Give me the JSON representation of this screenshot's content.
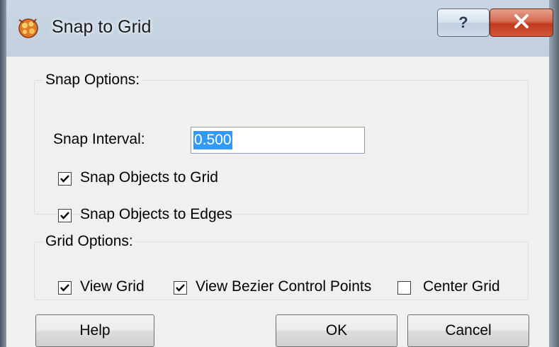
{
  "window": {
    "title": "Snap to Grid",
    "help_glyph": "?",
    "close_glyph": "X"
  },
  "snap_options": {
    "legend": "Snap Options:",
    "interval_label": "Snap Interval:",
    "interval_value": "0.500",
    "snap_objects_to_grid": {
      "label": "Snap Objects to Grid",
      "checked": true
    },
    "snap_objects_to_edges": {
      "label": "Snap Objects to Edges",
      "checked": true
    }
  },
  "grid_options": {
    "legend": "Grid Options:",
    "view_grid": {
      "label": "View Grid",
      "checked": true
    },
    "view_bezier_control_points": {
      "label": "View Bezier Control Points",
      "checked": true
    },
    "center_grid": {
      "label": "Center Grid",
      "checked": false
    }
  },
  "buttons": {
    "help": "Help",
    "ok": "OK",
    "cancel": "Cancel"
  },
  "icons": {
    "app": "snap-to-grid-app-icon",
    "help": "question-mark-icon",
    "close": "close-x-icon",
    "check": "checkmark-icon"
  },
  "colors": {
    "selection": "#3399ff",
    "close_button": "#c0391e",
    "dialog_background": "#f0f0f0"
  }
}
